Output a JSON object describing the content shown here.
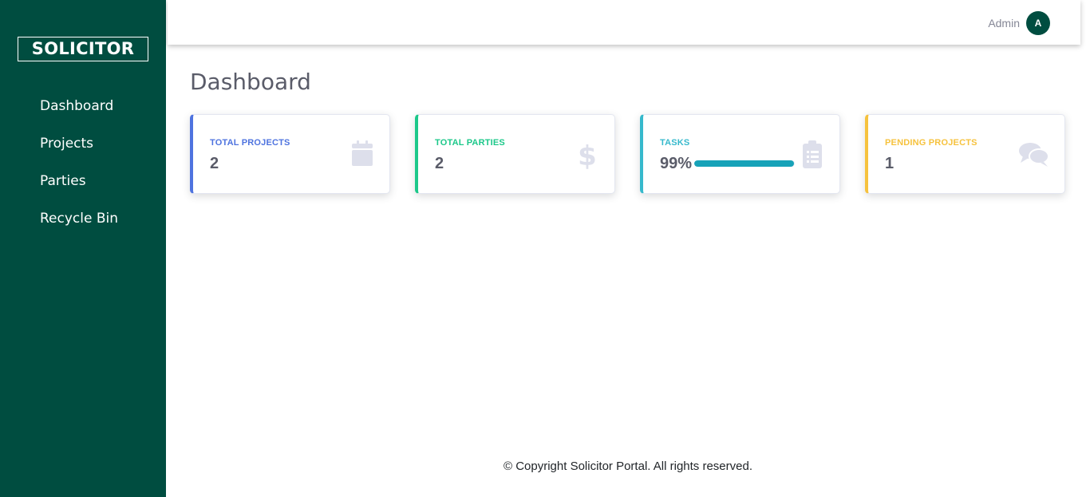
{
  "sidebar": {
    "brand": "SOLICITOR",
    "items": [
      {
        "label": "Dashboard"
      },
      {
        "label": "Projects"
      },
      {
        "label": "Parties"
      },
      {
        "label": "Recycle Bin"
      }
    ]
  },
  "topbar": {
    "user_name": "Admin",
    "avatar_initial": "A"
  },
  "main": {
    "title": "Dashboard",
    "cards": [
      {
        "label": "TOTAL PROJECTS",
        "value": "2",
        "icon": "calendar-icon",
        "accent": "#4e73df",
        "label_color": "#4e73df"
      },
      {
        "label": "TOTAL PARTIES",
        "value": "2",
        "icon": "dollar-icon",
        "accent": "#1cc88a",
        "label_color": "#1cc88a"
      },
      {
        "label": "TASKS",
        "value": "99%",
        "progress": 0.99,
        "icon": "clipboard-list-icon",
        "accent": "#36b9cc",
        "label_color": "#36b9cc"
      },
      {
        "label": "PENDING PROJECTS",
        "value": "1",
        "icon": "comments-icon",
        "accent": "#f6c23e",
        "label_color": "#f6c23e"
      }
    ]
  },
  "footer": {
    "text": "© Copyright Solicitor Portal. All rights reserved."
  },
  "colors": {
    "sidebar_bg": "#004d40",
    "icon_gray": "#dddfeb",
    "progress_fill": "#17a2b8"
  }
}
